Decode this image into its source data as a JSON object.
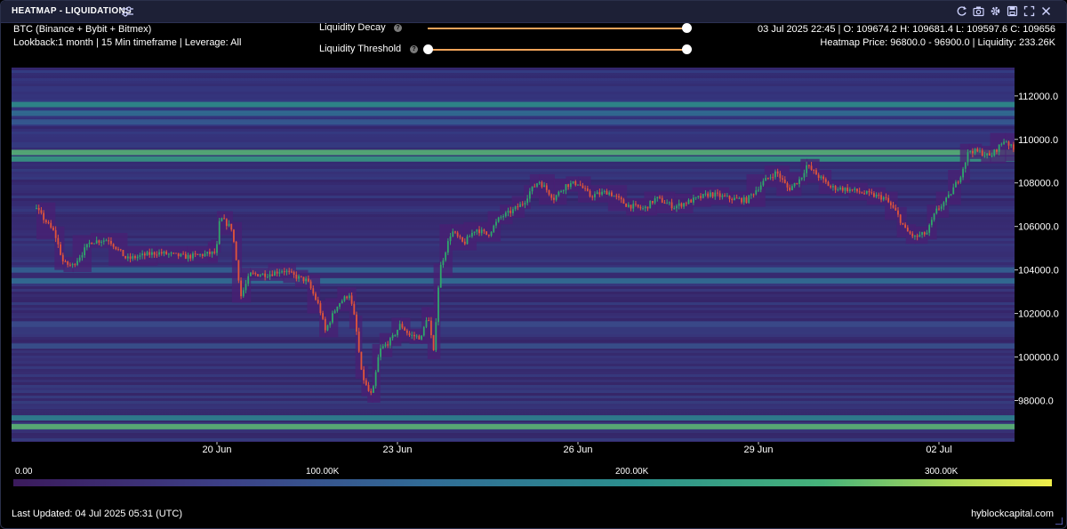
{
  "window": {
    "title": "HEATMAP - LIQUIDATIONS",
    "toolbar_icons": [
      "refresh-icon",
      "camera-icon",
      "gear-icon",
      "save-icon",
      "fullscreen-icon",
      "close-icon"
    ]
  },
  "info": {
    "symbol": "BTC (Binance + Bybit + Bitmex)",
    "settings": "Lookback:1 month | 15 Min timeframe | Leverage: All",
    "ohlc": "03 Jul 2025 22:45 | O: 109674.2 H: 109681.4 L: 109597.6 C: 109656",
    "heatmap_info": "Heatmap Price: 96800.0 - 96900.0 | Liquidity: 233.26K"
  },
  "controls": {
    "decay_label": "Liquidity Decay",
    "decay_value": 1.0,
    "threshold_label": "Liquidity Threshold",
    "threshold_range": [
      0.0,
      1.0
    ],
    "help_glyph": "?"
  },
  "colorbar": {
    "labels": [
      "0.00",
      "100.00K",
      "200.00K",
      "300.00K"
    ],
    "values": [
      0,
      100000,
      200000,
      300000
    ],
    "max": 330000,
    "colors": [
      "#3b1a5c",
      "#3c3f86",
      "#316c96",
      "#2b8f8d",
      "#46b37a",
      "#a7d65a",
      "#f0ee4a"
    ]
  },
  "footer": {
    "updated": "Last Updated: 04 Jul 2025 05:31 (UTC)",
    "brand": "hyblockcapital.com"
  },
  "chart_data": {
    "type": "heatmap",
    "overlay": "candlestick",
    "x_labels": [
      "20 Jun",
      "23 Jun",
      "26 Jun",
      "29 Jun",
      "02 Jul"
    ],
    "x_label_days": [
      3,
      6,
      9,
      12,
      15
    ],
    "x_range_days": [
      0,
      16.7
    ],
    "y_ticks": [
      112000,
      110000,
      108000,
      106000,
      104000,
      102000,
      100000,
      98000
    ],
    "y_tick_labels": [
      "112000.0",
      "110000.0",
      "108000.0",
      "106000.0",
      "104000.0",
      "102000.0",
      "100000.0",
      "98000.0"
    ],
    "ylim": [
      96100,
      113300
    ],
    "price_path": [
      {
        "d": 0.0,
        "p": 106800
      },
      {
        "d": 0.3,
        "p": 105700
      },
      {
        "d": 0.45,
        "p": 104300
      },
      {
        "d": 0.6,
        "p": 104200
      },
      {
        "d": 0.9,
        "p": 105300
      },
      {
        "d": 1.2,
        "p": 105400
      },
      {
        "d": 1.5,
        "p": 104500
      },
      {
        "d": 2.0,
        "p": 104800
      },
      {
        "d": 2.5,
        "p": 104600
      },
      {
        "d": 3.0,
        "p": 104800
      },
      {
        "d": 2.85,
        "p": 105000
      },
      {
        "d": 2.9,
        "p": 104700
      },
      {
        "d": 3.0,
        "p": 105100
      },
      {
        "d": 3.05,
        "p": 106400
      },
      {
        "d": 3.25,
        "p": 105900
      },
      {
        "d": 3.4,
        "p": 102800
      },
      {
        "d": 3.55,
        "p": 103800
      },
      {
        "d": 3.85,
        "p": 103800
      },
      {
        "d": 4.1,
        "p": 104000
      },
      {
        "d": 4.3,
        "p": 103700
      },
      {
        "d": 4.5,
        "p": 103500
      },
      {
        "d": 4.7,
        "p": 102300
      },
      {
        "d": 4.8,
        "p": 101200
      },
      {
        "d": 5.0,
        "p": 102400
      },
      {
        "d": 5.2,
        "p": 102900
      },
      {
        "d": 5.3,
        "p": 101600
      },
      {
        "d": 5.4,
        "p": 99300
      },
      {
        "d": 5.5,
        "p": 98500
      },
      {
        "d": 5.58,
        "p": 98200
      },
      {
        "d": 5.7,
        "p": 100300
      },
      {
        "d": 5.9,
        "p": 100800
      },
      {
        "d": 6.05,
        "p": 101500
      },
      {
        "d": 6.2,
        "p": 101000
      },
      {
        "d": 6.4,
        "p": 100900
      },
      {
        "d": 6.5,
        "p": 102000
      },
      {
        "d": 6.6,
        "p": 100200
      },
      {
        "d": 6.7,
        "p": 104000
      },
      {
        "d": 6.9,
        "p": 105800
      },
      {
        "d": 7.1,
        "p": 105200
      },
      {
        "d": 7.3,
        "p": 105900
      },
      {
        "d": 7.5,
        "p": 105600
      },
      {
        "d": 7.7,
        "p": 106400
      },
      {
        "d": 7.9,
        "p": 106700
      },
      {
        "d": 8.1,
        "p": 107100
      },
      {
        "d": 8.2,
        "p": 107600
      },
      {
        "d": 8.35,
        "p": 108100
      },
      {
        "d": 8.6,
        "p": 107300
      },
      {
        "d": 8.8,
        "p": 107900
      },
      {
        "d": 9.0,
        "p": 108000
      },
      {
        "d": 9.2,
        "p": 107400
      },
      {
        "d": 9.5,
        "p": 107600
      },
      {
        "d": 9.8,
        "p": 107000
      },
      {
        "d": 10.1,
        "p": 106800
      },
      {
        "d": 10.3,
        "p": 107300
      },
      {
        "d": 10.6,
        "p": 106900
      },
      {
        "d": 10.9,
        "p": 107200
      },
      {
        "d": 11.2,
        "p": 107500
      },
      {
        "d": 11.5,
        "p": 107300
      },
      {
        "d": 11.8,
        "p": 107200
      },
      {
        "d": 12.1,
        "p": 108100
      },
      {
        "d": 12.3,
        "p": 108500
      },
      {
        "d": 12.5,
        "p": 107700
      },
      {
        "d": 12.7,
        "p": 108200
      },
      {
        "d": 12.8,
        "p": 108800
      },
      {
        "d": 13.0,
        "p": 108300
      },
      {
        "d": 13.2,
        "p": 107800
      },
      {
        "d": 13.5,
        "p": 107700
      },
      {
        "d": 13.8,
        "p": 107500
      },
      {
        "d": 14.1,
        "p": 107300
      },
      {
        "d": 14.3,
        "p": 106600
      },
      {
        "d": 14.45,
        "p": 105800
      },
      {
        "d": 14.6,
        "p": 105500
      },
      {
        "d": 14.8,
        "p": 105700
      },
      {
        "d": 14.95,
        "p": 106700
      },
      {
        "d": 15.15,
        "p": 107300
      },
      {
        "d": 15.35,
        "p": 108300
      },
      {
        "d": 15.5,
        "p": 109500
      },
      {
        "d": 15.7,
        "p": 109400
      },
      {
        "d": 15.85,
        "p": 109200
      },
      {
        "d": 16.1,
        "p": 110000
      },
      {
        "d": 16.3,
        "p": 109300
      },
      {
        "d": 16.55,
        "p": 110200
      },
      {
        "d": 16.7,
        "p": 109650
      }
    ],
    "liquidity_bands": [
      {
        "p": 111600,
        "v": 170000
      },
      {
        "p": 111200,
        "v": 120000
      },
      {
        "p": 110800,
        "v": 90000
      },
      {
        "p": 109400,
        "v": 230000
      },
      {
        "p": 109100,
        "v": 190000
      },
      {
        "p": 104000,
        "v": 100000
      },
      {
        "p": 103500,
        "v": 120000
      },
      {
        "p": 101500,
        "v": 70000
      },
      {
        "p": 100500,
        "v": 80000
      },
      {
        "p": 97200,
        "v": 150000
      },
      {
        "p": 96800,
        "v": 233260
      }
    ]
  }
}
